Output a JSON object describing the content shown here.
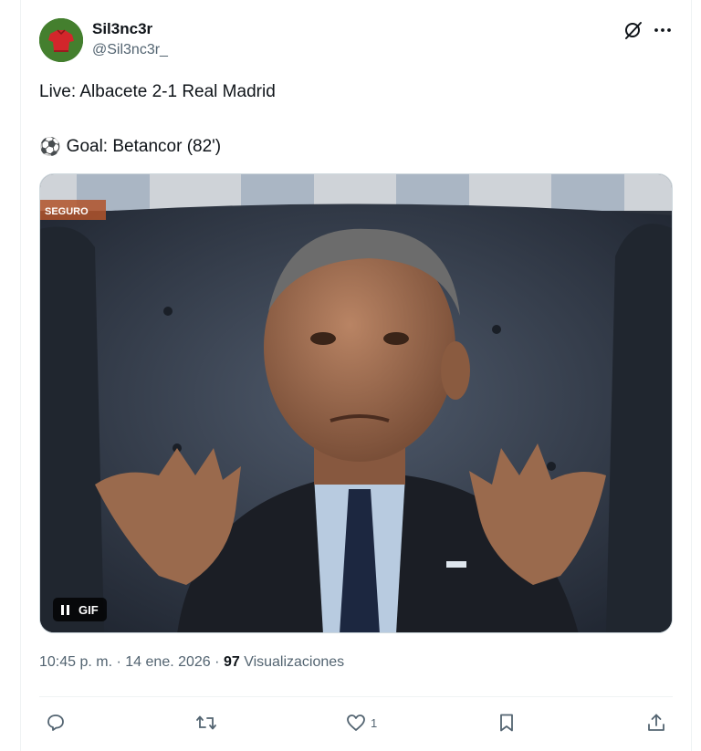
{
  "author": {
    "display_name": "Sil3nc3r",
    "handle": "@Sil3nc3r_",
    "avatar_icon": "red-jersey-avatar"
  },
  "tweet": {
    "line1": "Live: Albacete 2-1 Real Madrid",
    "line2_emoji": "⚽",
    "line2_text": "Goal: Betancor (82')"
  },
  "media": {
    "type": "gif",
    "gif_label": "GIF",
    "watermark": "SEGURO"
  },
  "meta": {
    "time": "10:45 p. m.",
    "separator": "·",
    "date": "14 ene. 2026",
    "views_count": "97",
    "views_label": "Visualizaciones"
  },
  "actions": {
    "like_count": "1"
  },
  "icons": {
    "grok": "grok-icon",
    "more": "more-icon",
    "reply": "reply-icon",
    "repost": "repost-icon",
    "like": "heart-icon",
    "bookmark": "bookmark-icon",
    "share": "share-icon"
  },
  "colors": {
    "text": "#0f1419",
    "secondary": "#536471",
    "border": "#eff3f4"
  }
}
